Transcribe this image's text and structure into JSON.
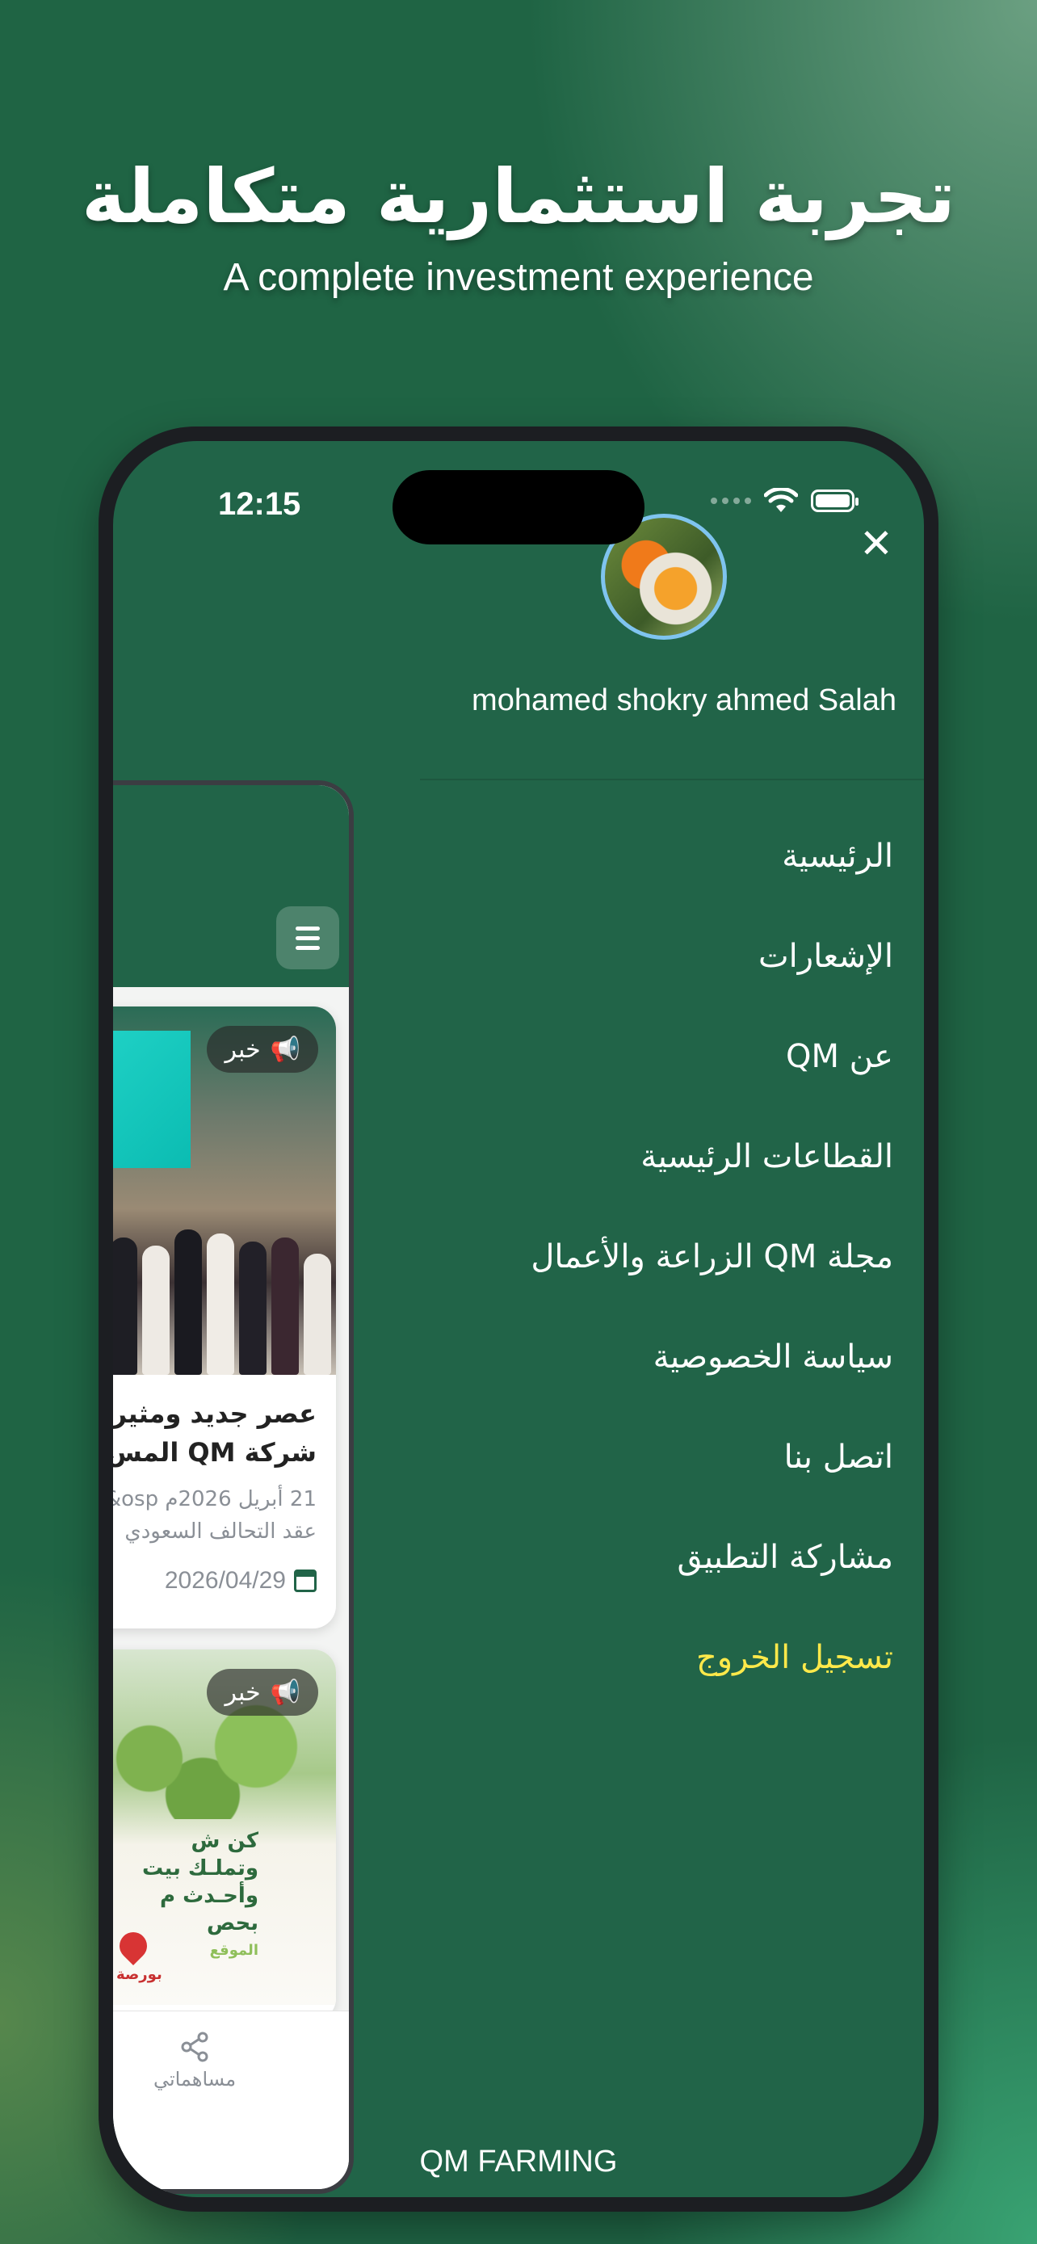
{
  "hero": {
    "title_ar": "تجربة استثمارية متكاملة",
    "subtitle_en": "A complete investment experience"
  },
  "status_bar": {
    "time": "12:15"
  },
  "drawer": {
    "username": "mohamed shokry ahmed Salah",
    "close_icon": "close-icon",
    "items": [
      {
        "label": "الرئيسية"
      },
      {
        "label": "الإشعارات"
      },
      {
        "label": "عن QM"
      },
      {
        "label": "القطاعات الرئيسية"
      },
      {
        "label": "مجلة QM الزراعة والأعمال"
      },
      {
        "label": "سياسة الخصوصية"
      },
      {
        "label": "اتصل بنا"
      },
      {
        "label": "مشاركة التطبيق"
      }
    ],
    "logout_label": "تسجيل الخروج",
    "logout_color": "#ffe94a",
    "footer_brand": "QM FARMING"
  },
  "preview": {
    "cards": [
      {
        "badge": "خبر",
        "title_line1": "عصر جديد ومثير",
        "title_line2": "شركة QM المس",
        "desc_line1": "21 أبريل 2026م osp&",
        "desc_line2": "عقد التحالف السعودي",
        "date": "2026/04/29"
      },
      {
        "badge": "خبر",
        "promo_line1": "كن ش",
        "promo_line2": "وتملـك بيت",
        "promo_line3": "وأحـدث م",
        "promo_line4": "بحص",
        "promo_tag": "الموقع",
        "promo_brand": "بورصة"
      }
    ],
    "tab_share_label": "مساهماتي"
  },
  "colors": {
    "primary_green": "#216448",
    "accent_yellow": "#ffe94a",
    "avatar_ring": "#7fc4ef"
  }
}
